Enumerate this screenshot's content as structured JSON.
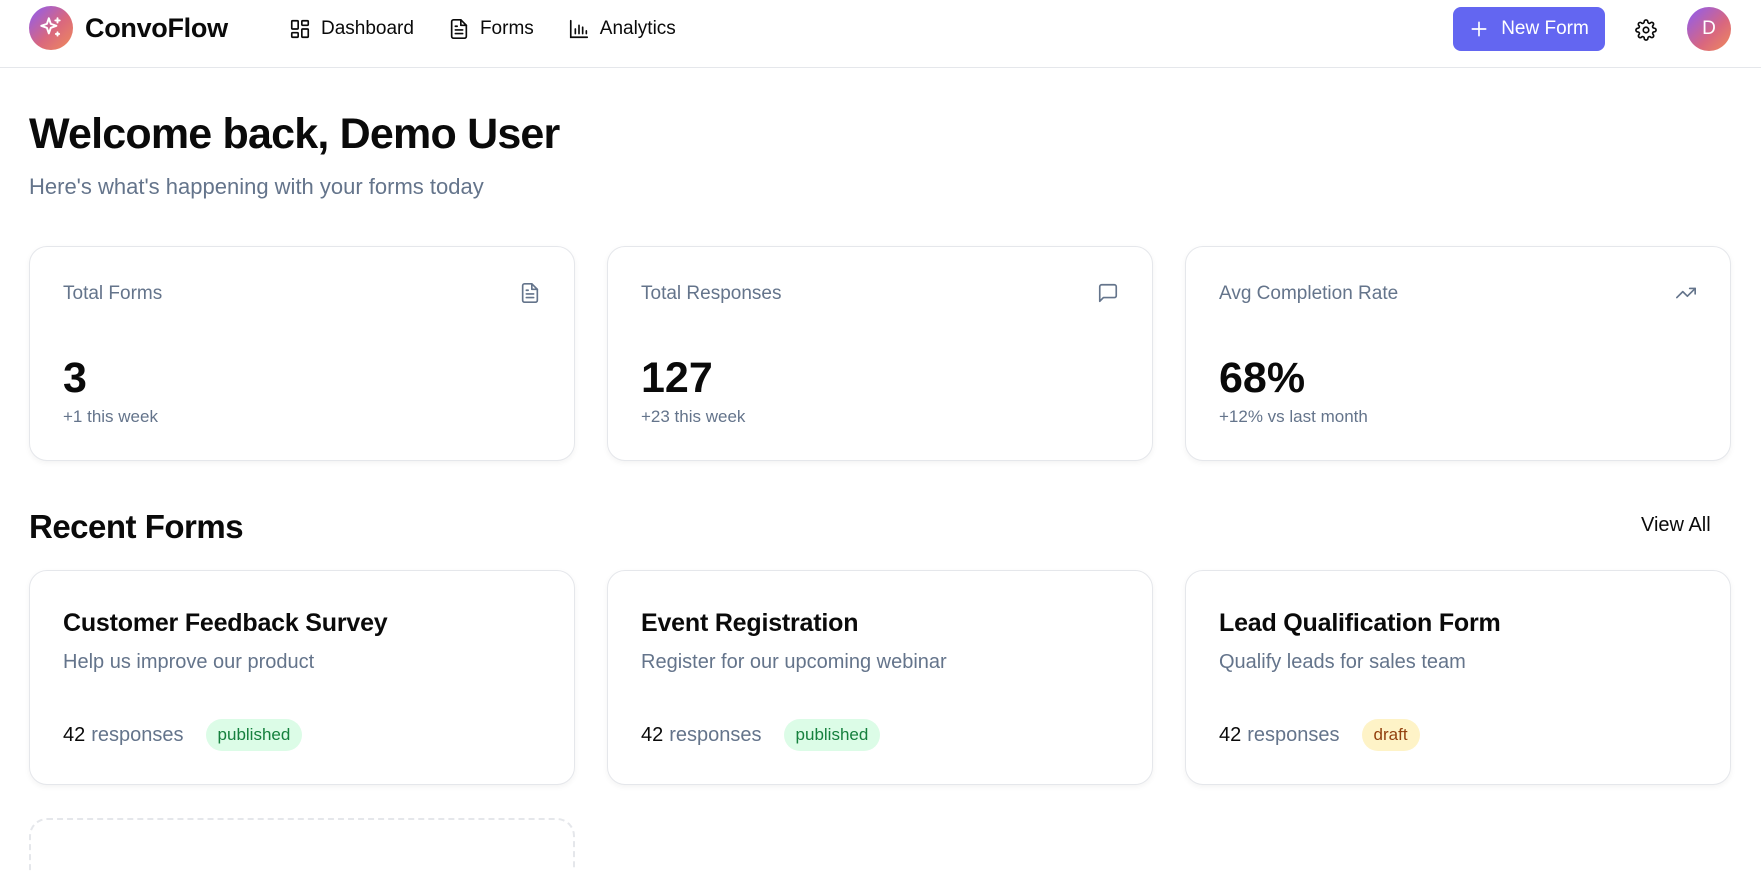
{
  "app": {
    "name": "ConvoFlow",
    "logo_icon": "sparkles-icon"
  },
  "nav": [
    {
      "label": "Dashboard",
      "icon": "dashboard-icon"
    },
    {
      "label": "Forms",
      "icon": "document-icon"
    },
    {
      "label": "Analytics",
      "icon": "bar-chart-icon"
    }
  ],
  "header": {
    "new_form_label": "New Form",
    "accent_color": "#6366f1",
    "avatar_initial": "D"
  },
  "welcome": {
    "title": "Welcome back, Demo User",
    "subtitle": "Here's what's happening with your forms today"
  },
  "stats": [
    {
      "label": "Total Forms",
      "value": "3",
      "change": "+1 this week",
      "icon": "document-icon"
    },
    {
      "label": "Total Responses",
      "value": "127",
      "change": "+23 this week",
      "icon": "message-icon"
    },
    {
      "label": "Avg Completion Rate",
      "value": "68%",
      "change": "+12% vs last month",
      "icon": "trending-up-icon"
    }
  ],
  "recent": {
    "title": "Recent Forms",
    "view_all": "View All",
    "forms": [
      {
        "title": "Customer Feedback Survey",
        "description": "Help us improve our product",
        "responses": "42",
        "responses_label": "responses",
        "status": "published"
      },
      {
        "title": "Event Registration",
        "description": "Register for our upcoming webinar",
        "responses": "42",
        "responses_label": "responses",
        "status": "published"
      },
      {
        "title": "Lead Qualification Form",
        "description": "Qualify leads for sales team",
        "responses": "42",
        "responses_label": "responses",
        "status": "draft"
      }
    ]
  },
  "colors": {
    "published_bg": "#dcfce7",
    "published_text": "#15803d",
    "draft_bg": "#fef3c7",
    "draft_text": "#92400e"
  }
}
